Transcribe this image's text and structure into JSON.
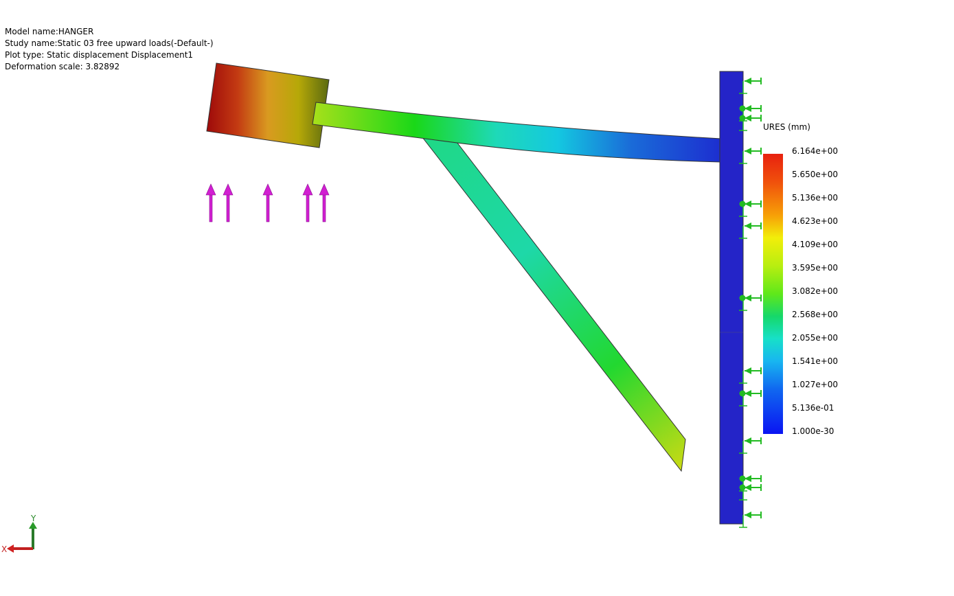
{
  "info": {
    "model_name": "Model name:HANGER",
    "study_name": "Study name:Static 03 free upward loads(-Default-)",
    "plot_type": "Plot type: Static displacement Displacement1",
    "deformation_scale": "Deformation scale: 3.82892"
  },
  "legend": {
    "title": "URES (mm)",
    "ticks": [
      "6.164e+00",
      "5.650e+00",
      "5.136e+00",
      "4.623e+00",
      "4.109e+00",
      "3.595e+00",
      "3.082e+00",
      "2.568e+00",
      "2.055e+00",
      "1.541e+00",
      "1.027e+00",
      "5.136e-01",
      "1.000e-30"
    ]
  },
  "axes": {
    "x_label": "X",
    "y_label": "Y"
  },
  "colors": {
    "load_arrow": "#d11fd1",
    "fixture": "#22bb22",
    "wall": "#2424c8"
  }
}
